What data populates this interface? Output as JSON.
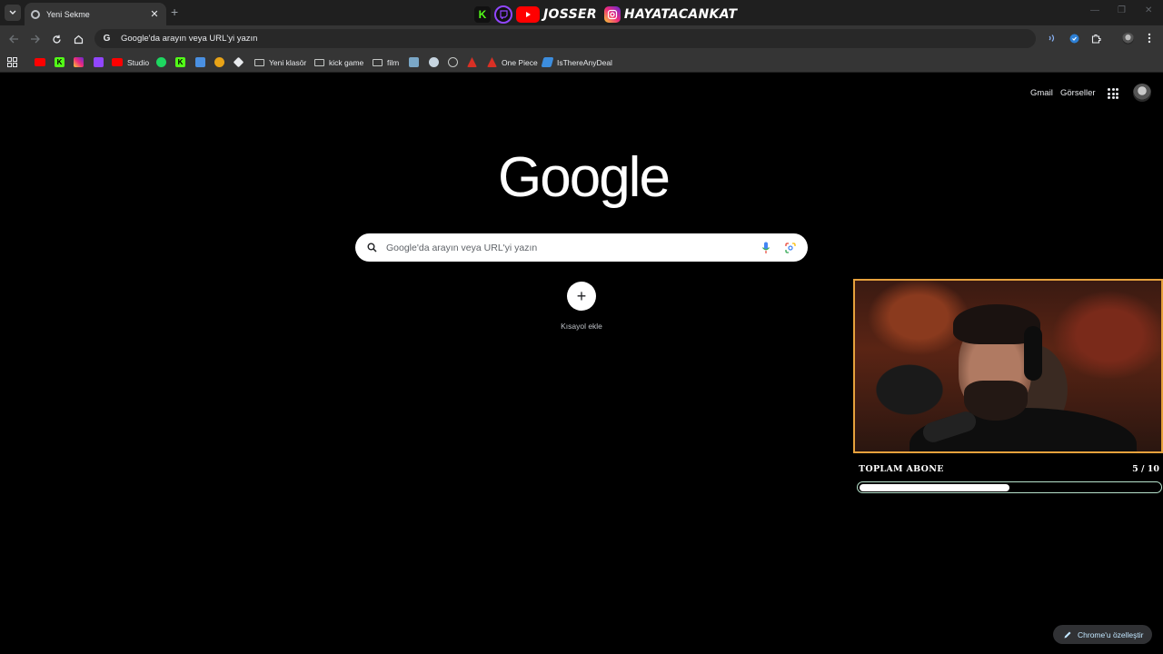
{
  "tab": {
    "title": "Yeni Sekme",
    "close": "✕",
    "new_tab": "+"
  },
  "window_controls": {
    "minimize": "—",
    "maximize": "❐",
    "close": "✕"
  },
  "overlay_banner": {
    "youtube_name": "JOSSER",
    "instagram_name": "HAYATACANKAT"
  },
  "omnibox": {
    "text": "Google'da arayın veya URL'yi yazın"
  },
  "bookmarks": {
    "studio": "Studio",
    "folder1": "Yeni klasör",
    "folder2": "kick game",
    "folder3": "film",
    "one_piece": "One Piece",
    "itad": "IsThereAnyDeal"
  },
  "header_links": {
    "gmail": "Gmail",
    "images": "Görseller"
  },
  "logo": "Google",
  "search": {
    "placeholder": "Google'da arayın veya URL'yi yazın"
  },
  "shortcut": {
    "label": "Kısayol ekle",
    "icon": "+"
  },
  "subscriber_goal": {
    "label": "TOPLAM ABONE",
    "current": 5,
    "target": 10,
    "display": "5 / 10",
    "progress": 0.5
  },
  "customize": {
    "label": "Chrome'u özelleştir"
  },
  "colors": {
    "page_bg": "#000000",
    "webcam_border": "#e6a13c",
    "progress_border": "#b7e3cc",
    "kick": "#53fc18",
    "twitch": "#9146ff",
    "youtube": "#ff0000"
  }
}
